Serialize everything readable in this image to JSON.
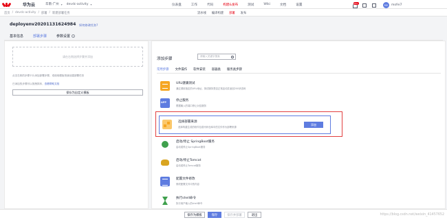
{
  "topbar": {
    "brand": "华为云",
    "region": "华南-广州",
    "project": "devdc-activity",
    "nav": [
      "仪表盘",
      "工作",
      "代码",
      "构建&发布",
      "测试",
      "Wiki",
      "文档",
      "设置"
    ],
    "active_nav": "构建&发布",
    "badge": "99+",
    "avatar": "MO",
    "user": "mofei7"
  },
  "subbar": {
    "breadcrumb": [
      "首页",
      "/",
      "devdc-activity",
      "/",
      "部署",
      "/",
      "新建部署任务"
    ],
    "subnav": [
      "流水线",
      "编译构建",
      "部署",
      "发布"
    ],
    "active_subnav": "部署"
  },
  "task": {
    "title": "deployenv20201131624984",
    "link": "如何修改任务?",
    "tabs": [
      "基本信息",
      "部署步骤",
      "参数设置"
    ]
  },
  "left": {
    "dropzone": "请在右侧选择步骤并添加",
    "desc1": "点击右侧的步骤卡片添加部署步骤，或使用模板快速创建部署任务",
    "desc2_prefix": "已添加的步骤可以拖拽排序，",
    "desc2_link": "查看帮助文档",
    "button": "保存为自定义模板"
  },
  "right": {
    "title": "添加步骤",
    "search_placeholder": "请输入关键字搜索",
    "categories": [
      "常用步骤",
      "文件操作",
      "软件安装",
      "容器类",
      "服务类步骤"
    ],
    "steps": [
      {
        "name": "URL健康测试",
        "desc": "通过调用指定的URL地址，测试服务是否正常启动并返回200状态码"
      },
      {
        "name": "停止服务",
        "desc": "根据输入的端口停止对应服务"
      },
      {
        "name": "选择部署来源",
        "desc": "选择构建生成的软件包或代码仓库中的文件作为部署来源"
      },
      {
        "name": "启动/停止 SpringBoot服务",
        "desc": "启动或停止SpringBoot服务"
      },
      {
        "name": "启动/停止Tomcat",
        "desc": "启动或停止Tomcat服务"
      },
      {
        "name": "配置文件修改",
        "desc": "修改配置文件中的内容"
      },
      {
        "name": "执行shell命令",
        "desc": "执行用户输入的shell命令"
      }
    ],
    "add_button": "添加"
  },
  "bottom": {
    "save_template": "保存为模板",
    "save": "保存",
    "save_deploy": "保存并部署",
    "exit": "退出",
    "watermark": "https://blog.csdn.net/weixin_41457652"
  },
  "colors": {
    "accent": "#5e7ce0",
    "brand": "#e60012",
    "highlight": "#e23e3e"
  }
}
